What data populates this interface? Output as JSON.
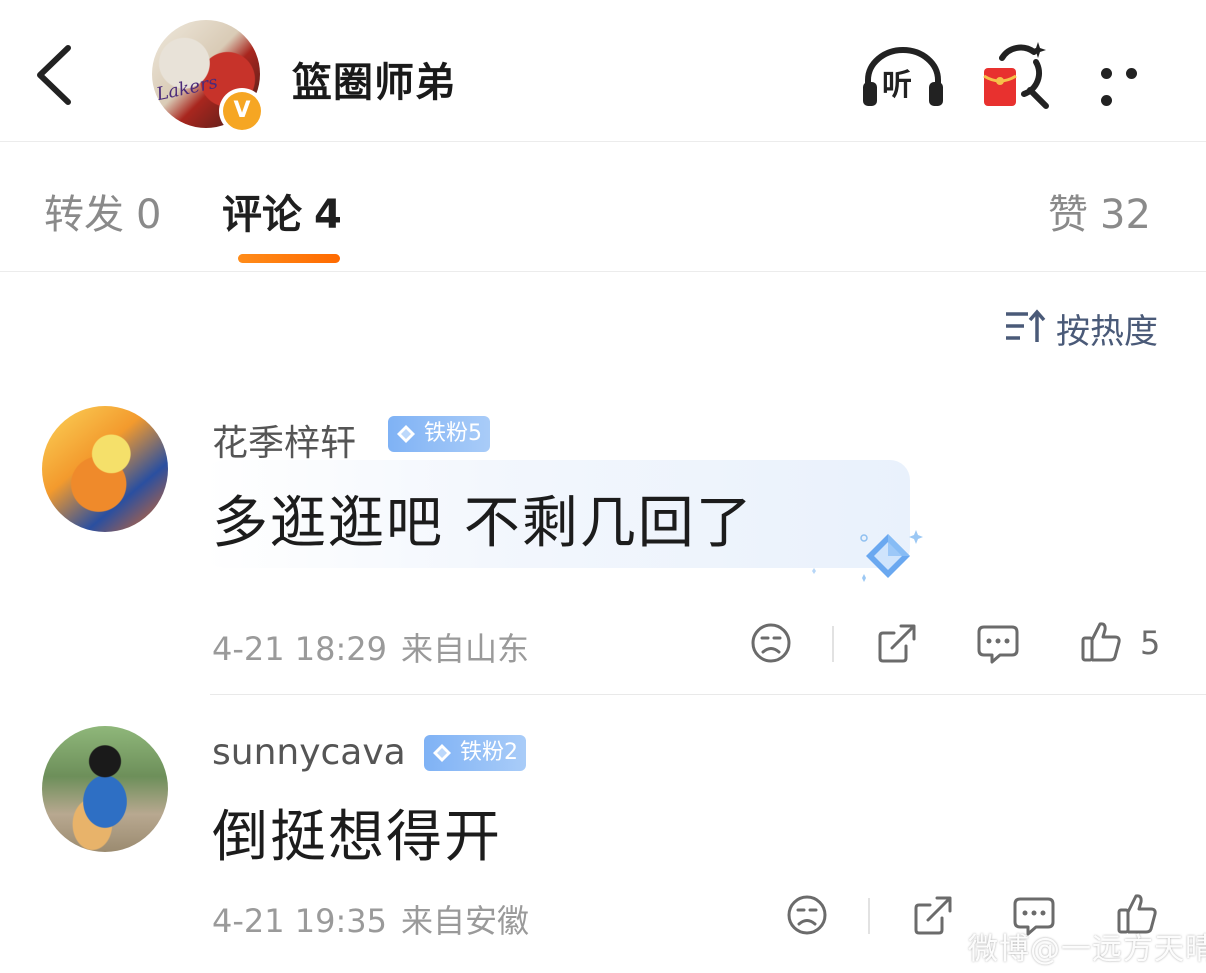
{
  "header": {
    "title": "篮圈师弟",
    "verified_badge": "V",
    "avatar_jersey_text": "Lakers",
    "listen_label": "听"
  },
  "tabs": {
    "repost_label": "转发",
    "repost_count": "0",
    "comment_label": "评论",
    "comment_count": "4",
    "like_label": "赞",
    "like_count": "32",
    "active": "comment"
  },
  "sort": {
    "label": "按热度"
  },
  "comments": [
    {
      "username": "花季梓轩",
      "fan_badge": "铁粉5",
      "text": "多逛逛吧 不剩几回了",
      "date": "4-21 18:29",
      "location": "来自山东",
      "like_count": "5"
    },
    {
      "username": "sunnycava",
      "fan_badge": "铁粉2",
      "text": "倒挺想得开",
      "date": "4-21 19:35",
      "location": "来自安徽",
      "like_count": ""
    }
  ],
  "watermark": "微博@一远方天晴",
  "colors": {
    "accent": "#ff7a00",
    "fan_badge": "#7fb2f5",
    "verified": "#f6a623",
    "red_packet": "#e8312f",
    "sort_text": "#4a5a78"
  },
  "icons": [
    "back-arrow-icon",
    "headphones-icon",
    "red-packet-search-icon",
    "more-dots-icon",
    "sort-icon",
    "diamond-icon",
    "sad-face-icon",
    "share-icon",
    "comment-icon",
    "thumbs-up-icon"
  ]
}
